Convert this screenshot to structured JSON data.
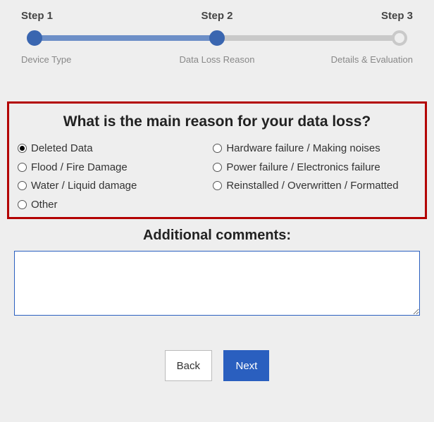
{
  "stepper": {
    "steps": [
      {
        "top": "Step 1",
        "bottom": "Device Type"
      },
      {
        "top": "Step 2",
        "bottom": "Data Loss Reason"
      },
      {
        "top": "Step 3",
        "bottom": "Details & Evaluation"
      }
    ],
    "current_index": 1
  },
  "question": {
    "title": "What is the main reason for your data loss?",
    "selected": "deleted-data",
    "options_left": [
      {
        "id": "deleted-data",
        "label": "Deleted Data"
      },
      {
        "id": "flood-fire",
        "label": "Flood / Fire Damage"
      },
      {
        "id": "water-liquid",
        "label": "Water / Liquid damage"
      },
      {
        "id": "other",
        "label": "Other"
      }
    ],
    "options_right": [
      {
        "id": "hw-failure",
        "label": "Hardware failure / Making noises"
      },
      {
        "id": "power-failure",
        "label": "Power failure / Electronics failure"
      },
      {
        "id": "reinstalled",
        "label": "Reinstalled / Overwritten / Formatted"
      }
    ]
  },
  "comments": {
    "title": "Additional comments:",
    "value": ""
  },
  "buttons": {
    "back": "Back",
    "next": "Next"
  }
}
